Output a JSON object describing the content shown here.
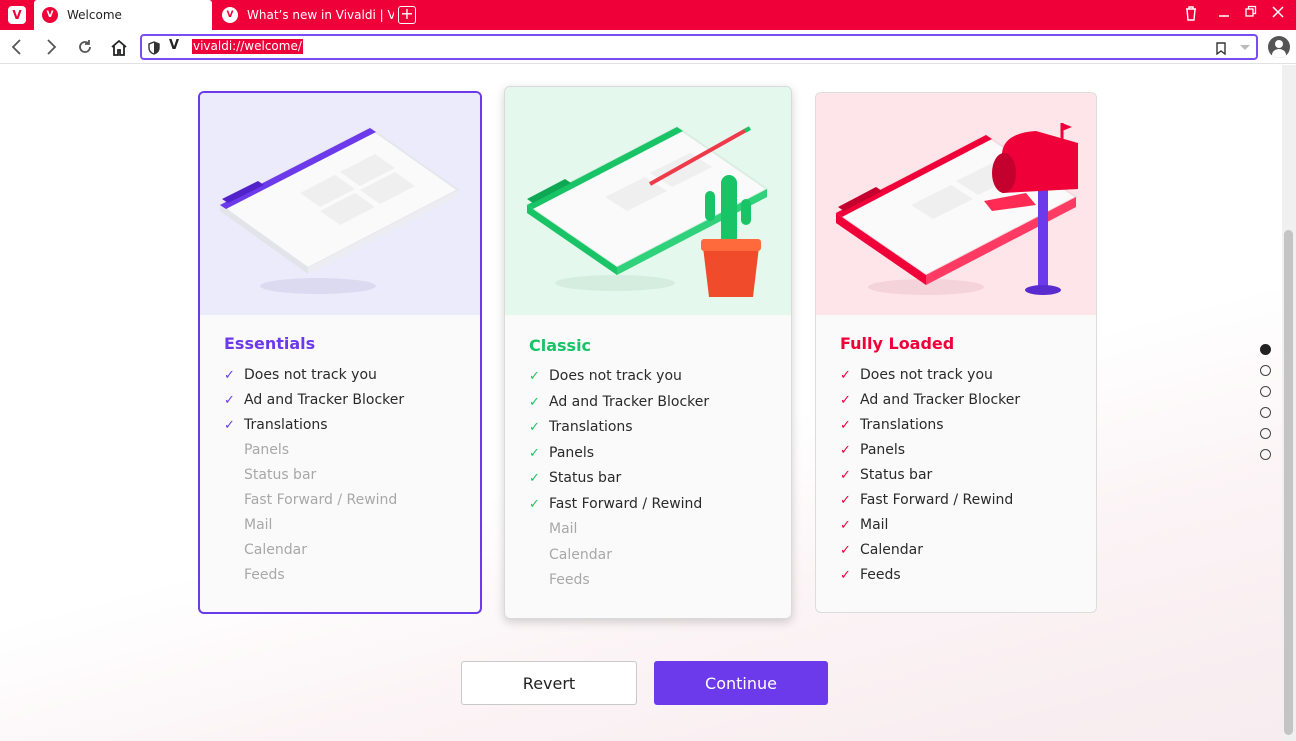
{
  "browser": {
    "logo": "V",
    "tabs": [
      {
        "title": "Welcome",
        "active": true
      },
      {
        "title": "What’s new in Vivaldi | Viva",
        "active": false
      }
    ],
    "new_tab_label": "+",
    "address": {
      "url": "vivaldi://welcome/",
      "site_mark": "V"
    }
  },
  "cards": [
    {
      "title": "Essentials",
      "accent": "#6c3aeb",
      "check": "✓",
      "features": [
        {
          "label": "Does not track you",
          "on": true
        },
        {
          "label": "Ad and Tracker Blocker",
          "on": true
        },
        {
          "label": "Translations",
          "on": true
        },
        {
          "label": "Panels",
          "on": false
        },
        {
          "label": "Status bar",
          "on": false
        },
        {
          "label": "Fast Forward / Rewind",
          "on": false
        },
        {
          "label": "Mail",
          "on": false
        },
        {
          "label": "Calendar",
          "on": false
        },
        {
          "label": "Feeds",
          "on": false
        }
      ]
    },
    {
      "title": "Classic",
      "accent": "#19c467",
      "check": "✓",
      "features": [
        {
          "label": "Does not track you",
          "on": true
        },
        {
          "label": "Ad and Tracker Blocker",
          "on": true
        },
        {
          "label": "Translations",
          "on": true
        },
        {
          "label": "Panels",
          "on": true
        },
        {
          "label": "Status bar",
          "on": true
        },
        {
          "label": "Fast Forward / Rewind",
          "on": true
        },
        {
          "label": "Mail",
          "on": false
        },
        {
          "label": "Calendar",
          "on": false
        },
        {
          "label": "Feeds",
          "on": false
        }
      ]
    },
    {
      "title": "Fully Loaded",
      "accent": "#ef0039",
      "check": "✓",
      "features": [
        {
          "label": "Does not track you",
          "on": true
        },
        {
          "label": "Ad and Tracker Blocker",
          "on": true
        },
        {
          "label": "Translations",
          "on": true
        },
        {
          "label": "Panels",
          "on": true
        },
        {
          "label": "Status bar",
          "on": true
        },
        {
          "label": "Fast Forward / Rewind",
          "on": true
        },
        {
          "label": "Mail",
          "on": true
        },
        {
          "label": "Calendar",
          "on": true
        },
        {
          "label": "Feeds",
          "on": true
        }
      ]
    }
  ],
  "pager": {
    "count": 6,
    "active_index": 0
  },
  "actions": {
    "revert_label": "Revert",
    "continue_label": "Continue"
  }
}
